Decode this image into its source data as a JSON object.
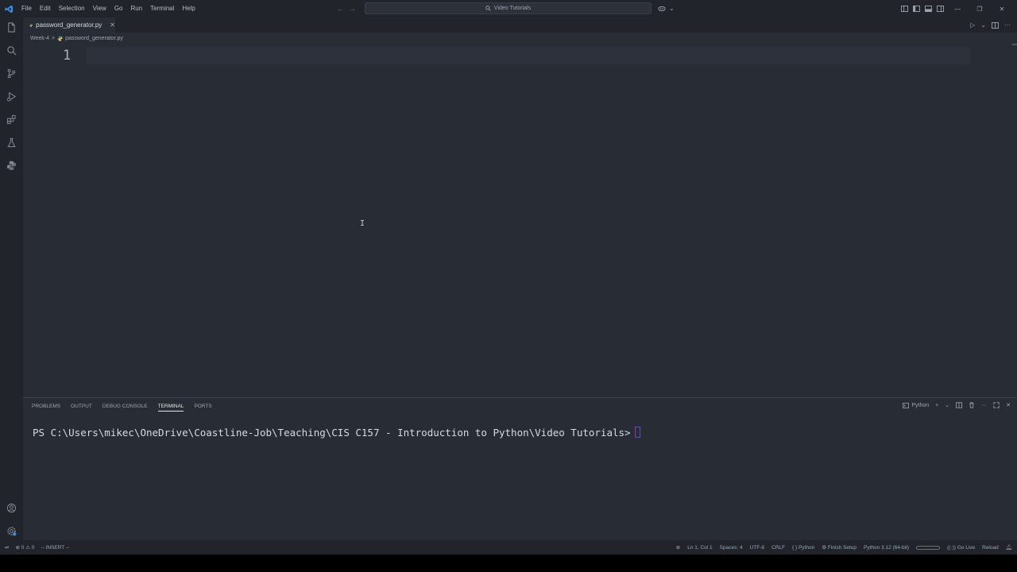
{
  "window": {
    "search": "Video Tutorials"
  },
  "menu": [
    "File",
    "Edit",
    "Selection",
    "View",
    "Go",
    "Run",
    "Terminal",
    "Help"
  ],
  "tab": {
    "label": "password_generator.py",
    "close": "✕"
  },
  "breadcrumb": {
    "folder": "Week-4",
    "separator": ">",
    "file": "password_generator.py"
  },
  "editor": {
    "line_number": "1"
  },
  "panel": {
    "tabs": [
      "PROBLEMS",
      "OUTPUT",
      "DEBUG CONSOLE",
      "TERMINAL",
      "PORTS"
    ],
    "active_tab": "TERMINAL",
    "terminal_profile": "Python",
    "prompt": "PS C:\\Users\\mikec\\OneDrive\\Coastline-Job\\Teaching\\CIS C157 - Introduction to Python\\Video Tutorials>"
  },
  "status": {
    "errors": "0",
    "warnings": "0",
    "mode": "-- INSERT --",
    "position": "Ln 1, Col 1",
    "spaces": "Spaces: 4",
    "encoding": "UTF-8",
    "eol": "CRLF",
    "language": "Python",
    "finish_setup": "Finish Setup",
    "interpreter": "Python 3.12 (64-bit)",
    "go_live": "Go Live",
    "reload": "Reload"
  },
  "colors": {
    "background": "#282c34",
    "chrome": "#21252b",
    "accent": "#3b8eea",
    "cursor": "#7a3fd1"
  }
}
